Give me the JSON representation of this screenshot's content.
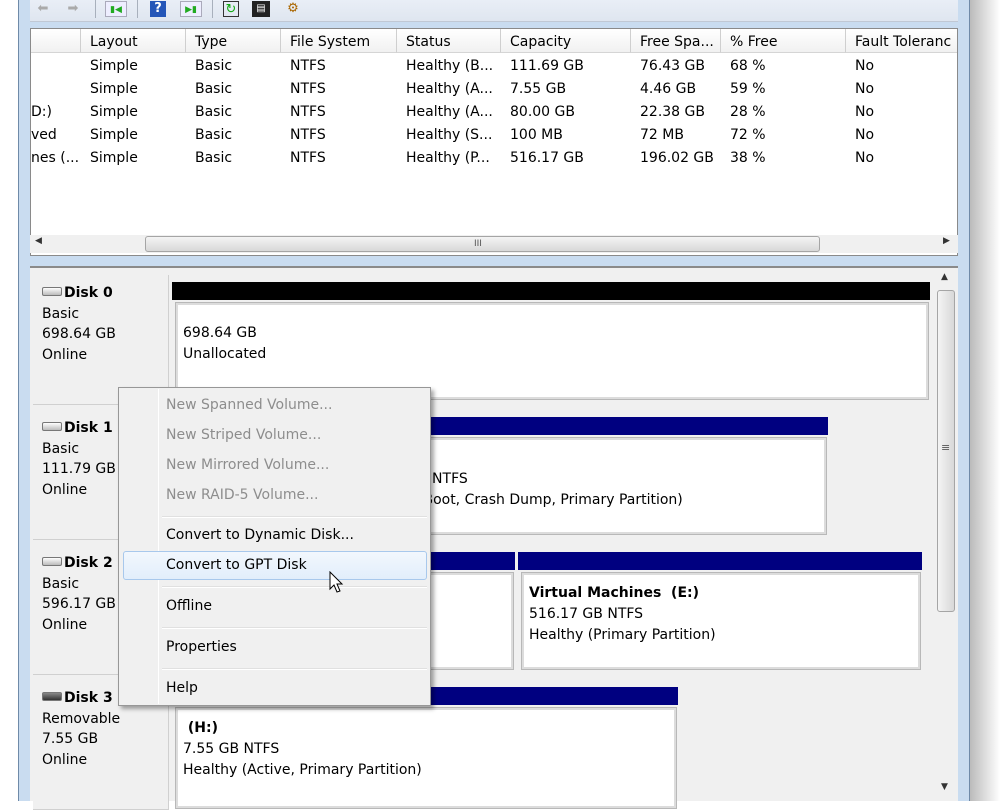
{
  "toolbar": {
    "icons": [
      "back-arrow-icon",
      "forward-arrow-icon",
      "show-hide-console-tree-icon",
      "help-icon",
      "show-hide-action-pane-icon",
      "refresh-icon",
      "properties-icon",
      "settings-icon"
    ]
  },
  "volume_list": {
    "columns": [
      "",
      "Layout",
      "Type",
      "File System",
      "Status",
      "Capacity",
      "Free Spa...",
      "% Free",
      "Fault Toleranc"
    ],
    "rows": [
      [
        "",
        "Simple",
        "Basic",
        "NTFS",
        "Healthy (B...",
        "111.69 GB",
        "76.43 GB",
        "68 %",
        "No"
      ],
      [
        "",
        "Simple",
        "Basic",
        "NTFS",
        "Healthy (A...",
        "7.55 GB",
        "4.46 GB",
        "59 %",
        "No"
      ],
      [
        "D:)",
        "Simple",
        "Basic",
        "NTFS",
        "Healthy (A...",
        "80.00 GB",
        "22.38 GB",
        "28 %",
        "No"
      ],
      [
        "ved",
        "Simple",
        "Basic",
        "NTFS",
        "Healthy (S...",
        "100 MB",
        "72 MB",
        "72 %",
        "No"
      ],
      [
        "nes (...",
        "Simple",
        "Basic",
        "NTFS",
        "Healthy (P...",
        "516.17 GB",
        "196.02 GB",
        "38 %",
        "No"
      ]
    ],
    "hscroll_grip": "III"
  },
  "disks": [
    {
      "name": "Disk 0",
      "type": "Basic",
      "size": "698.64 GB",
      "state": "Online",
      "partitions": [
        {
          "title": "",
          "line1": "698.64 GB",
          "line2": "Unallocated",
          "bar_color": "#000000"
        }
      ]
    },
    {
      "name": "Disk 1",
      "type": "Basic",
      "size": "111.79 GB",
      "state": "Online",
      "partitions": [
        {
          "title": "",
          "line1": "B NTFS",
          "line2": "(Boot, Crash Dump, Primary Partition)",
          "bar_color": "#000080"
        }
      ]
    },
    {
      "name": "Disk 2",
      "type": "Basic",
      "size": "596.17 GB",
      "state": "Online",
      "partitions": [
        {
          "title": "",
          "line1": "",
          "line2": "",
          "bar_color": "#000080"
        },
        {
          "title": "Virtual Machines  (E:)",
          "line1": "516.17 GB NTFS",
          "line2": "Healthy (Primary Partition)",
          "bar_color": "#000080"
        }
      ]
    },
    {
      "name": "Disk 3",
      "type": "Removable",
      "size": "7.55 GB",
      "state": "Online",
      "partitions": [
        {
          "title": " (H:)",
          "line1": "7.55 GB NTFS",
          "line2": "Healthy (Active, Primary Partition)",
          "bar_color": "#000080"
        }
      ]
    }
  ],
  "vscroll_grip": "≡",
  "context_menu": {
    "items": [
      {
        "label": "New Spanned Volume...",
        "enabled": false
      },
      {
        "label": "New Striped Volume...",
        "enabled": false
      },
      {
        "label": "New Mirrored Volume...",
        "enabled": false
      },
      {
        "label": "New RAID-5 Volume...",
        "enabled": false
      },
      {
        "label": "Convert to Dynamic Disk...",
        "enabled": true
      },
      {
        "label": "Convert to GPT Disk",
        "enabled": true,
        "highlighted": true
      },
      {
        "label": "Offline",
        "enabled": true
      },
      {
        "label": "Properties",
        "enabled": true
      },
      {
        "label": "Help",
        "enabled": true
      }
    ]
  }
}
